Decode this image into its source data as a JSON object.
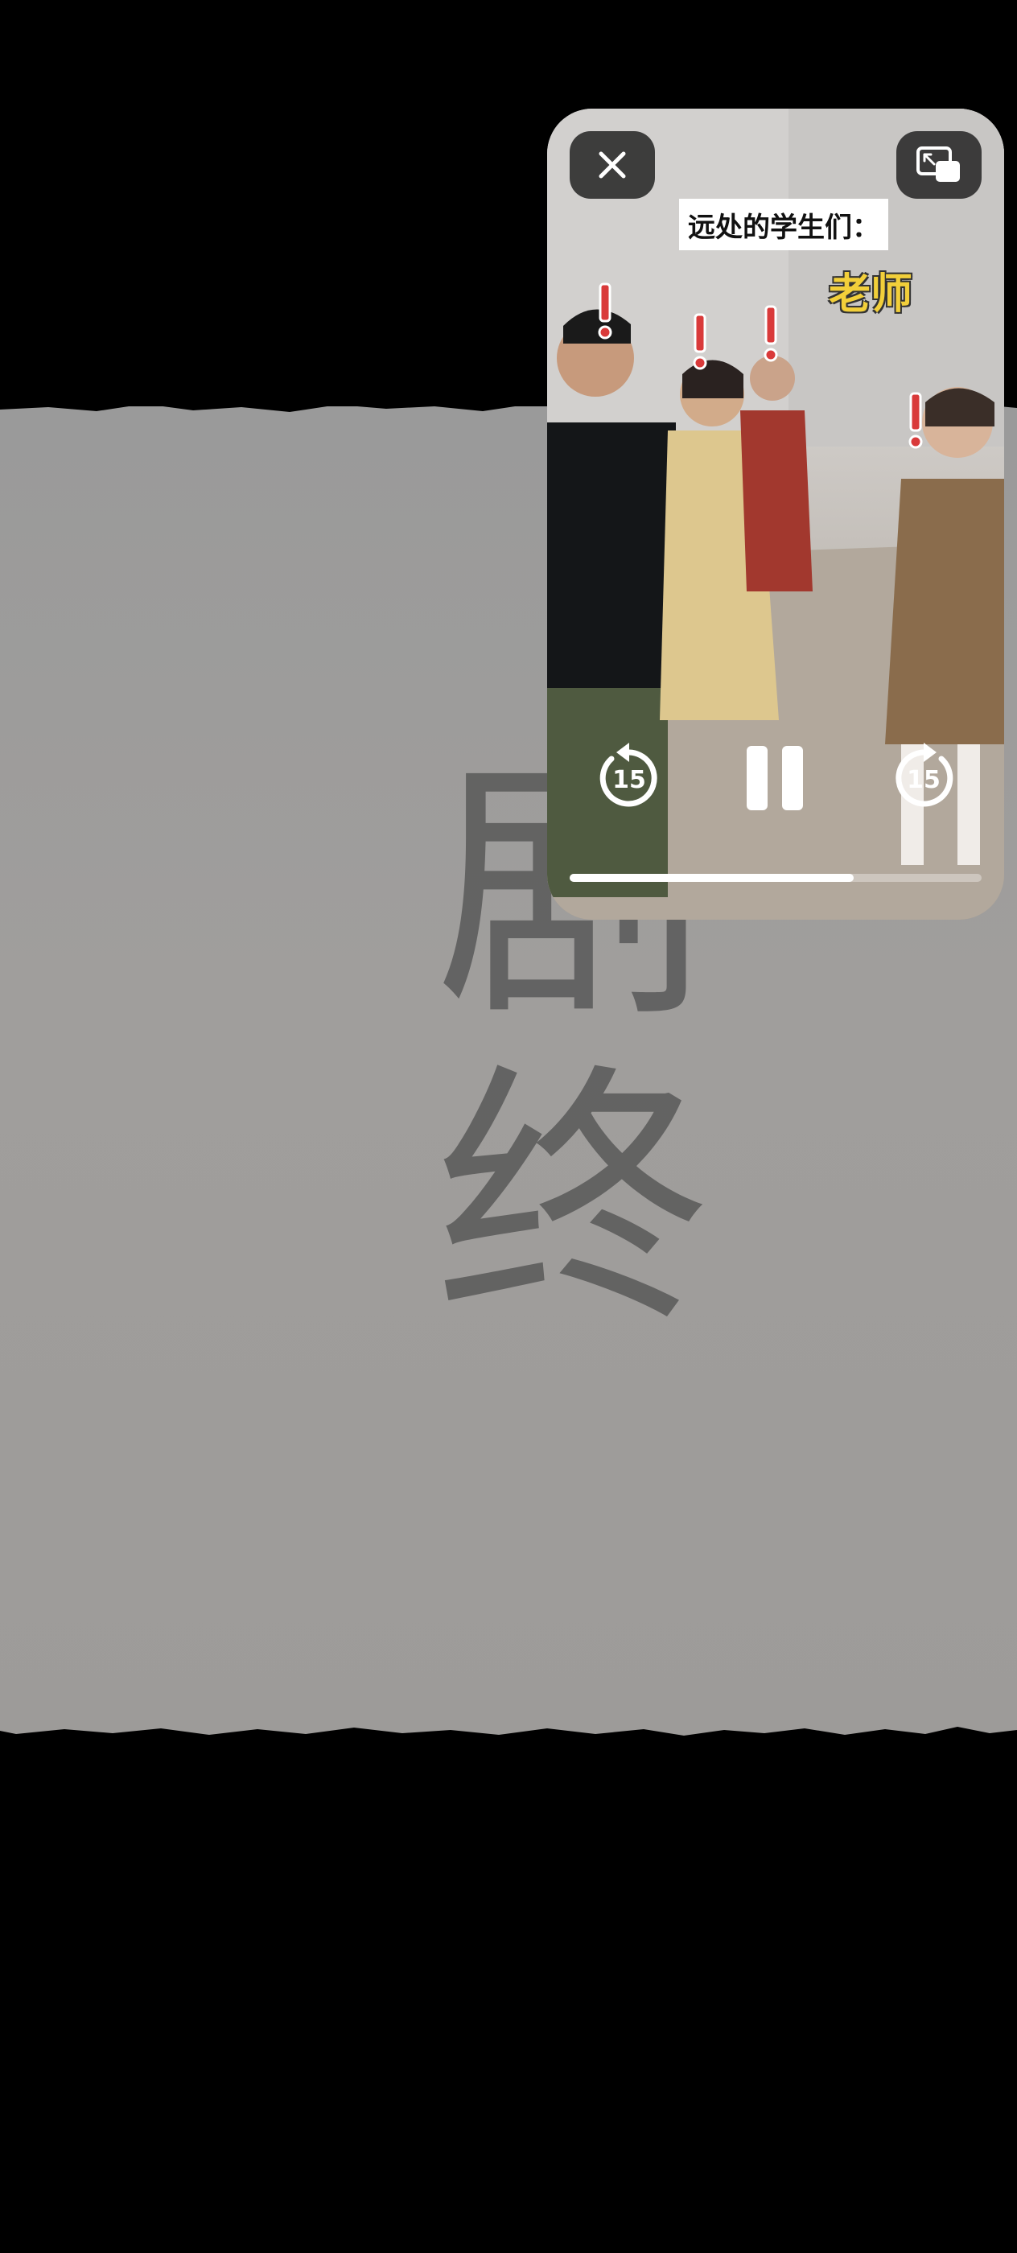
{
  "pip": {
    "subtitle": "远处的学生们：",
    "caption": "老师",
    "skip_seconds_back": "15",
    "skip_seconds_forward": "15",
    "progress": 0.69,
    "icons": {
      "close": "close-icon",
      "expand": "expand-pip-icon",
      "skip_back": "skip-back-15-icon",
      "pause": "pause-icon",
      "skip_forward": "skip-forward-15-icon"
    }
  },
  "background": {
    "calligraphy": "剧终"
  },
  "colors": {
    "caption_yellow": "#f2cf3a",
    "exclamation_red": "#d93a3a",
    "button_bg": "#282828"
  }
}
